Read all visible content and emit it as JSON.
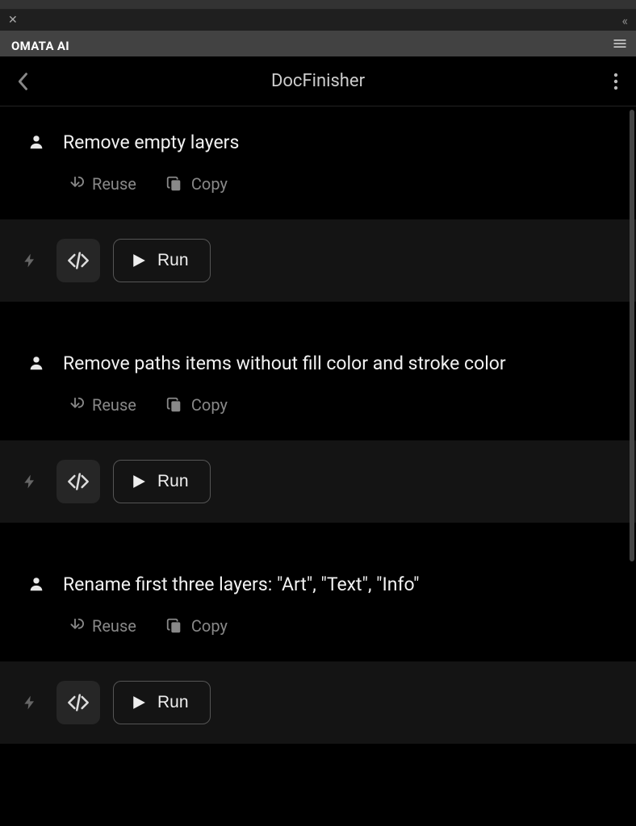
{
  "tab_name": "OMATA AI",
  "header": {
    "title": "DocFinisher"
  },
  "common": {
    "reuse": "Reuse",
    "copy": "Copy",
    "run": "Run"
  },
  "entries": [
    {
      "prompt": "Remove empty layers"
    },
    {
      "prompt": "Remove paths items without fill color and stroke color"
    },
    {
      "prompt": "Rename first three layers: \"Art\", \"Text\", \"Info\""
    }
  ]
}
